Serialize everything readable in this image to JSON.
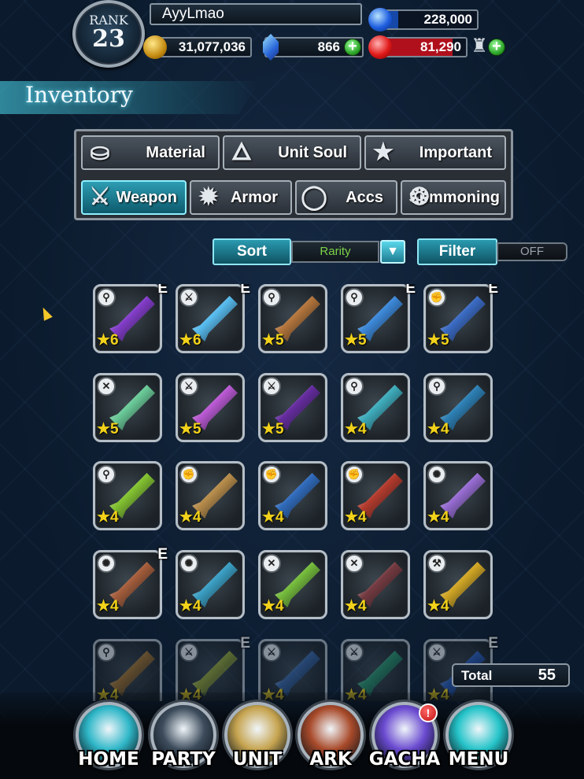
{
  "player": {
    "rank_label": "RANK",
    "rank_value": "23",
    "name": "AyyLmao",
    "gil": "31,077,036",
    "lapis": "866",
    "blue_stat": "228,000",
    "red_stat": "81,290"
  },
  "page": {
    "title": "Inventory"
  },
  "categories": [
    {
      "label": "Material",
      "icon": "sack-icon",
      "active": false
    },
    {
      "label": "Unit Soul",
      "icon": "soul-flame-icon",
      "active": false
    },
    {
      "label": "Important",
      "icon": "star-icon",
      "active": false
    },
    {
      "label": "Weapon",
      "icon": "sword-icon",
      "active": true
    },
    {
      "label": "Armor",
      "icon": "armor-icon",
      "active": false
    },
    {
      "label": "Accs",
      "icon": "ring-icon",
      "active": false
    },
    {
      "label": "Summoning",
      "icon": "summon-icon",
      "active": false
    }
  ],
  "sort": {
    "label": "Sort",
    "value": "Rarity"
  },
  "filter": {
    "label": "Filter",
    "value": "OFF"
  },
  "items": [
    {
      "type": "staff",
      "e": true,
      "stars": "6",
      "color": "#8a3bd6"
    },
    {
      "type": "sword",
      "e": true,
      "stars": "6",
      "color": "#5ac8ff"
    },
    {
      "type": "staff",
      "e": false,
      "stars": "5",
      "color": "#c07a3a"
    },
    {
      "type": "staff",
      "e": true,
      "stars": "5",
      "color": "#3c8fe8"
    },
    {
      "type": "fist",
      "e": true,
      "stars": "5",
      "color": "#3a6ed0"
    },
    {
      "type": "bow",
      "e": false,
      "stars": "5",
      "color": "#6fd8a0"
    },
    {
      "type": "sword",
      "e": false,
      "stars": "5",
      "color": "#c65ae0"
    },
    {
      "type": "sword",
      "e": false,
      "stars": "5",
      "color": "#6a2aa8"
    },
    {
      "type": "staff",
      "e": false,
      "stars": "4",
      "color": "#3fb7c8"
    },
    {
      "type": "staff",
      "e": false,
      "stars": "4",
      "color": "#2b86c0"
    },
    {
      "type": "staff",
      "e": false,
      "stars": "4",
      "color": "#8acf2e"
    },
    {
      "type": "fist",
      "e": false,
      "stars": "4",
      "color": "#c4934a"
    },
    {
      "type": "fist",
      "e": false,
      "stars": "4",
      "color": "#2f6fc8"
    },
    {
      "type": "fist",
      "e": false,
      "stars": "4",
      "color": "#c03a2a"
    },
    {
      "type": "gun",
      "e": false,
      "stars": "4",
      "color": "#a070e0"
    },
    {
      "type": "gun",
      "e": true,
      "stars": "4",
      "color": "#b0603a"
    },
    {
      "type": "gun",
      "e": false,
      "stars": "4",
      "color": "#3aa8d0"
    },
    {
      "type": "bow",
      "e": false,
      "stars": "4",
      "color": "#7ac83a"
    },
    {
      "type": "bow",
      "e": false,
      "stars": "4",
      "color": "#7a3a40"
    },
    {
      "type": "hammer",
      "e": false,
      "stars": "4",
      "color": "#e0b020"
    },
    {
      "type": "staff",
      "e": false,
      "stars": "4",
      "color": "#b0782a"
    },
    {
      "type": "sword",
      "e": true,
      "stars": "4",
      "color": "#a0b030"
    },
    {
      "type": "sword",
      "e": false,
      "stars": "4",
      "color": "#3a6ab0"
    },
    {
      "type": "sword",
      "e": false,
      "stars": "4",
      "color": "#2aa070"
    },
    {
      "type": "sword",
      "e": true,
      "stars": "4",
      "color": "#2a60c8"
    }
  ],
  "type_icons": {
    "staff": "⚲",
    "sword": "⚔",
    "fist": "✊",
    "bow": "✕",
    "gun": "✺",
    "hammer": "⚒"
  },
  "total": {
    "label": "Total",
    "value": "55"
  },
  "nav": [
    {
      "label": "HOME",
      "icon": "home-icon",
      "color": "#2fb7c8",
      "badge": ""
    },
    {
      "label": "PARTY",
      "icon": "party-icon",
      "color": "#3d4c5c",
      "badge": ""
    },
    {
      "label": "UNIT",
      "icon": "unit-icon",
      "color": "#c6a450",
      "badge": ""
    },
    {
      "label": "ARK",
      "icon": "ark-icon",
      "color": "#a84a2a",
      "badge": ""
    },
    {
      "label": "GACHA",
      "icon": "gacha-icon",
      "color": "#6a4ad0",
      "badge": "!"
    },
    {
      "label": "MENU",
      "icon": "menu-icon",
      "color": "#25c4c9",
      "badge": ""
    }
  ]
}
